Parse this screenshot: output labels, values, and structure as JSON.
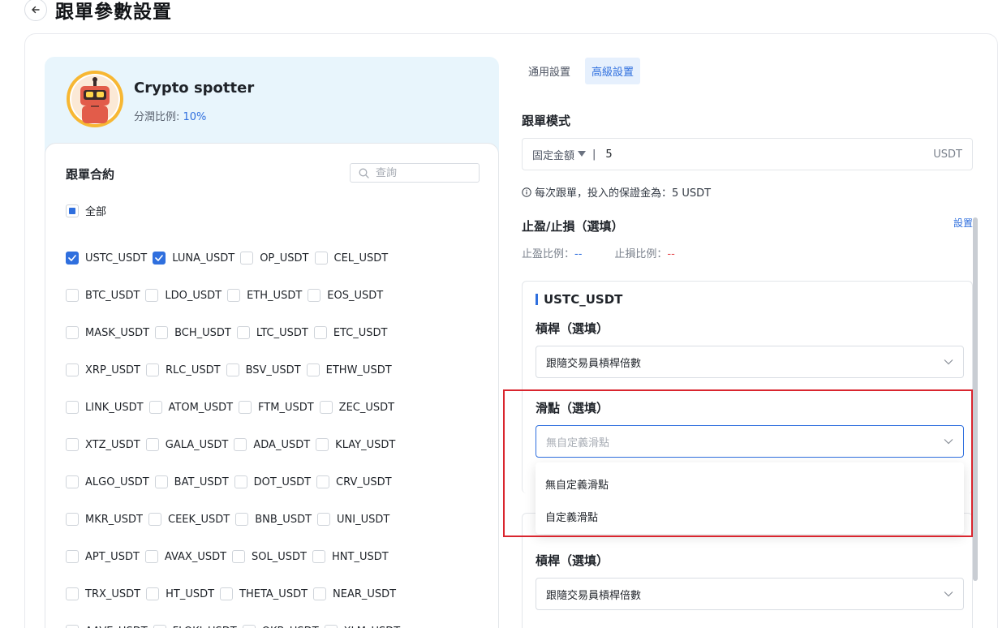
{
  "page": {
    "title": "跟單參數設置"
  },
  "trader": {
    "name": "Crypto spotter",
    "share_label": "分潤比例: ",
    "share_value": "10%"
  },
  "contracts": {
    "title": "跟單合約",
    "search_placeholder": "查詢",
    "all_label": "全部",
    "rows": [
      [
        {
          "label": "USTC_USDT",
          "checked": true
        },
        {
          "label": "LUNA_USDT",
          "checked": true
        },
        {
          "label": "OP_USDT",
          "checked": false
        },
        {
          "label": "CEL_USDT",
          "checked": false
        }
      ],
      [
        {
          "label": "BTC_USDT",
          "checked": false
        },
        {
          "label": "LDO_USDT",
          "checked": false
        },
        {
          "label": "ETH_USDT",
          "checked": false
        },
        {
          "label": "EOS_USDT",
          "checked": false
        }
      ],
      [
        {
          "label": "MASK_USDT",
          "checked": false
        },
        {
          "label": "BCH_USDT",
          "checked": false
        },
        {
          "label": "LTC_USDT",
          "checked": false
        },
        {
          "label": "ETC_USDT",
          "checked": false
        }
      ],
      [
        {
          "label": "XRP_USDT",
          "checked": false
        },
        {
          "label": "RLC_USDT",
          "checked": false
        },
        {
          "label": "BSV_USDT",
          "checked": false
        },
        {
          "label": "ETHW_USDT",
          "checked": false
        }
      ],
      [
        {
          "label": "LINK_USDT",
          "checked": false
        },
        {
          "label": "ATOM_USDT",
          "checked": false
        },
        {
          "label": "FTM_USDT",
          "checked": false
        },
        {
          "label": "ZEC_USDT",
          "checked": false
        }
      ],
      [
        {
          "label": "XTZ_USDT",
          "checked": false
        },
        {
          "label": "GALA_USDT",
          "checked": false
        },
        {
          "label": "ADA_USDT",
          "checked": false
        },
        {
          "label": "KLAY_USDT",
          "checked": false
        }
      ],
      [
        {
          "label": "ALGO_USDT",
          "checked": false
        },
        {
          "label": "BAT_USDT",
          "checked": false
        },
        {
          "label": "DOT_USDT",
          "checked": false
        },
        {
          "label": "CRV_USDT",
          "checked": false
        }
      ],
      [
        {
          "label": "MKR_USDT",
          "checked": false
        },
        {
          "label": "CEEK_USDT",
          "checked": false
        },
        {
          "label": "BNB_USDT",
          "checked": false
        },
        {
          "label": "UNI_USDT",
          "checked": false
        }
      ],
      [
        {
          "label": "APT_USDT",
          "checked": false
        },
        {
          "label": "AVAX_USDT",
          "checked": false
        },
        {
          "label": "SOL_USDT",
          "checked": false
        },
        {
          "label": "HNT_USDT",
          "checked": false
        }
      ],
      [
        {
          "label": "TRX_USDT",
          "checked": false
        },
        {
          "label": "HT_USDT",
          "checked": false
        },
        {
          "label": "THETA_USDT",
          "checked": false
        },
        {
          "label": "NEAR_USDT",
          "checked": false
        }
      ],
      [
        {
          "label": "AAVE_USDT",
          "checked": false
        },
        {
          "label": "FLOKI_USDT",
          "checked": false
        },
        {
          "label": "OKB_USDT",
          "checked": false
        },
        {
          "label": "XLM_USDT",
          "checked": false
        }
      ]
    ]
  },
  "tabs": [
    {
      "label": "通用設置",
      "active": false
    },
    {
      "label": "高級設置",
      "active": true
    }
  ],
  "mode": {
    "title": "跟單模式",
    "select_value": "固定金額",
    "separator": "|",
    "amount": "5",
    "unit": "USDT",
    "hint": "每次跟單，投入的保證金為：5 USDT"
  },
  "tpsl": {
    "title": "止盈/止損（選填）",
    "set_label": "設置",
    "tp_label": "止盈比例：",
    "tp_value": "--",
    "sl_label": "止損比例：",
    "sl_value": "--"
  },
  "pair": {
    "name": "USTC_USDT",
    "leverage_title": "槓桿（選填）",
    "leverage_value": "跟隨交易員槓桿倍數",
    "slippage_title": "滑點（選填）",
    "slippage_placeholder": "無自定義滑點",
    "slippage_options": [
      "無自定義滑點",
      "自定義滑點"
    ]
  },
  "pair2": {
    "leverage_title": "槓桿（選填）",
    "leverage_value": "跟隨交易員槓桿倍數"
  },
  "colors": {
    "accent": "#2f6fde",
    "highlight": "#d9252e",
    "card_bg": "#e8f5fc"
  }
}
